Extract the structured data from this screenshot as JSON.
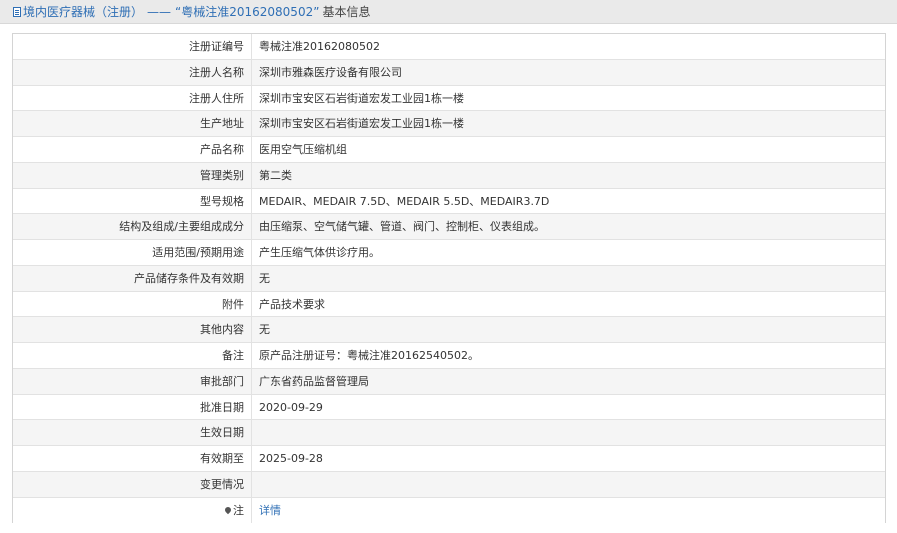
{
  "header": {
    "breadcrumb_link": "境内医疗器械（注册）",
    "separator": "——",
    "record_title": "“粤械注准20162080502”",
    "suffix": "基本信息"
  },
  "rows": [
    {
      "label": "注册证编号",
      "value": "粤械注准20162080502"
    },
    {
      "label": "注册人名称",
      "value": "深圳市雅森医疗设备有限公司"
    },
    {
      "label": "注册人住所",
      "value": "深圳市宝安区石岩街道宏发工业园1栋一楼"
    },
    {
      "label": "生产地址",
      "value": "深圳市宝安区石岩街道宏发工业园1栋一楼"
    },
    {
      "label": "产品名称",
      "value": "医用空气压缩机组"
    },
    {
      "label": "管理类别",
      "value": "第二类"
    },
    {
      "label": "型号规格",
      "value": "MEDAIR、MEDAIR 7.5D、MEDAIR 5.5D、MEDAIR3.7D"
    },
    {
      "label": "结构及组成/主要组成成分",
      "value": "由压缩泵、空气储气罐、管道、阀门、控制柜、仪表组成。"
    },
    {
      "label": "适用范围/预期用途",
      "value": "产生压缩气体供诊疗用。"
    },
    {
      "label": "产品储存条件及有效期",
      "value": "无"
    },
    {
      "label": "附件",
      "value": "产品技术要求"
    },
    {
      "label": "其他内容",
      "value": "无"
    },
    {
      "label": "备注",
      "value": "原产品注册证号：粤械注准20162540502。"
    },
    {
      "label": "审批部门",
      "value": "广东省药品监督管理局"
    },
    {
      "label": "批准日期",
      "value": "2020-09-29"
    },
    {
      "label": "生效日期",
      "value": ""
    },
    {
      "label": "有效期至",
      "value": "2025-09-28"
    },
    {
      "label": "变更情况",
      "value": ""
    }
  ],
  "note_row": {
    "label": "注",
    "link": "详情"
  }
}
